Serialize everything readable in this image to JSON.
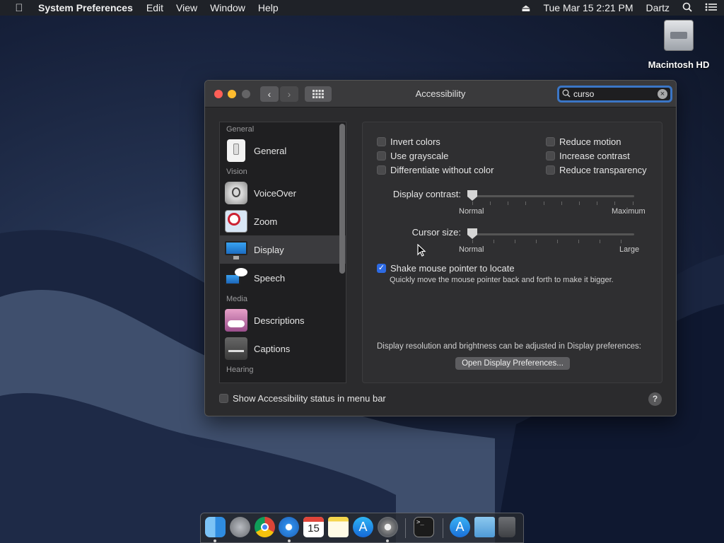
{
  "menubar": {
    "app_name": "System Preferences",
    "menus": [
      "Edit",
      "View",
      "Window",
      "Help"
    ],
    "clock": "Tue Mar 15  2:21 PM",
    "user": "Dartz"
  },
  "desktop": {
    "drive_label": "Macintosh HD"
  },
  "window": {
    "title": "Accessibility",
    "search_value": "curso"
  },
  "sidebar": {
    "headers": [
      "General",
      "Vision",
      "Media",
      "Hearing"
    ],
    "items": [
      {
        "label": "General",
        "icon": "switch-icon"
      },
      {
        "label": "VoiceOver",
        "icon": "voiceover-icon"
      },
      {
        "label": "Zoom",
        "icon": "magnifier-icon"
      },
      {
        "label": "Display",
        "icon": "monitor-icon"
      },
      {
        "label": "Speech",
        "icon": "speech-bubble-icon"
      },
      {
        "label": "Descriptions",
        "icon": "descriptions-icon"
      },
      {
        "label": "Captions",
        "icon": "captions-icon"
      }
    ],
    "selected": "Display"
  },
  "display": {
    "checkboxes_left": [
      {
        "label": "Invert colors",
        "checked": false
      },
      {
        "label": "Use grayscale",
        "checked": false
      },
      {
        "label": "Differentiate without color",
        "checked": false
      }
    ],
    "checkboxes_right": [
      {
        "label": "Reduce motion",
        "checked": false
      },
      {
        "label": "Increase contrast",
        "checked": false
      },
      {
        "label": "Reduce transparency",
        "checked": false
      }
    ],
    "contrast": {
      "label": "Display contrast:",
      "min": "Normal",
      "max": "Maximum",
      "value": 0
    },
    "cursor": {
      "label": "Cursor size:",
      "min": "Normal",
      "max": "Large",
      "value": 0
    },
    "shake": {
      "label": "Shake mouse pointer to locate",
      "checked": true,
      "description": "Quickly move the mouse pointer back and forth to make it bigger."
    },
    "resolution_note": "Display resolution and brightness can be adjusted in Display preferences:",
    "open_button": "Open Display Preferences..."
  },
  "footer": {
    "status_label": "Show Accessibility status in menu bar",
    "status_checked": false,
    "help": "?"
  },
  "dock": {
    "calendar_day": "15",
    "apps": [
      "finder",
      "launchpad",
      "chrome",
      "safari",
      "calendar",
      "notes",
      "app-store",
      "system-preferences",
      "terminal",
      "downloads",
      "folder",
      "trash"
    ]
  }
}
